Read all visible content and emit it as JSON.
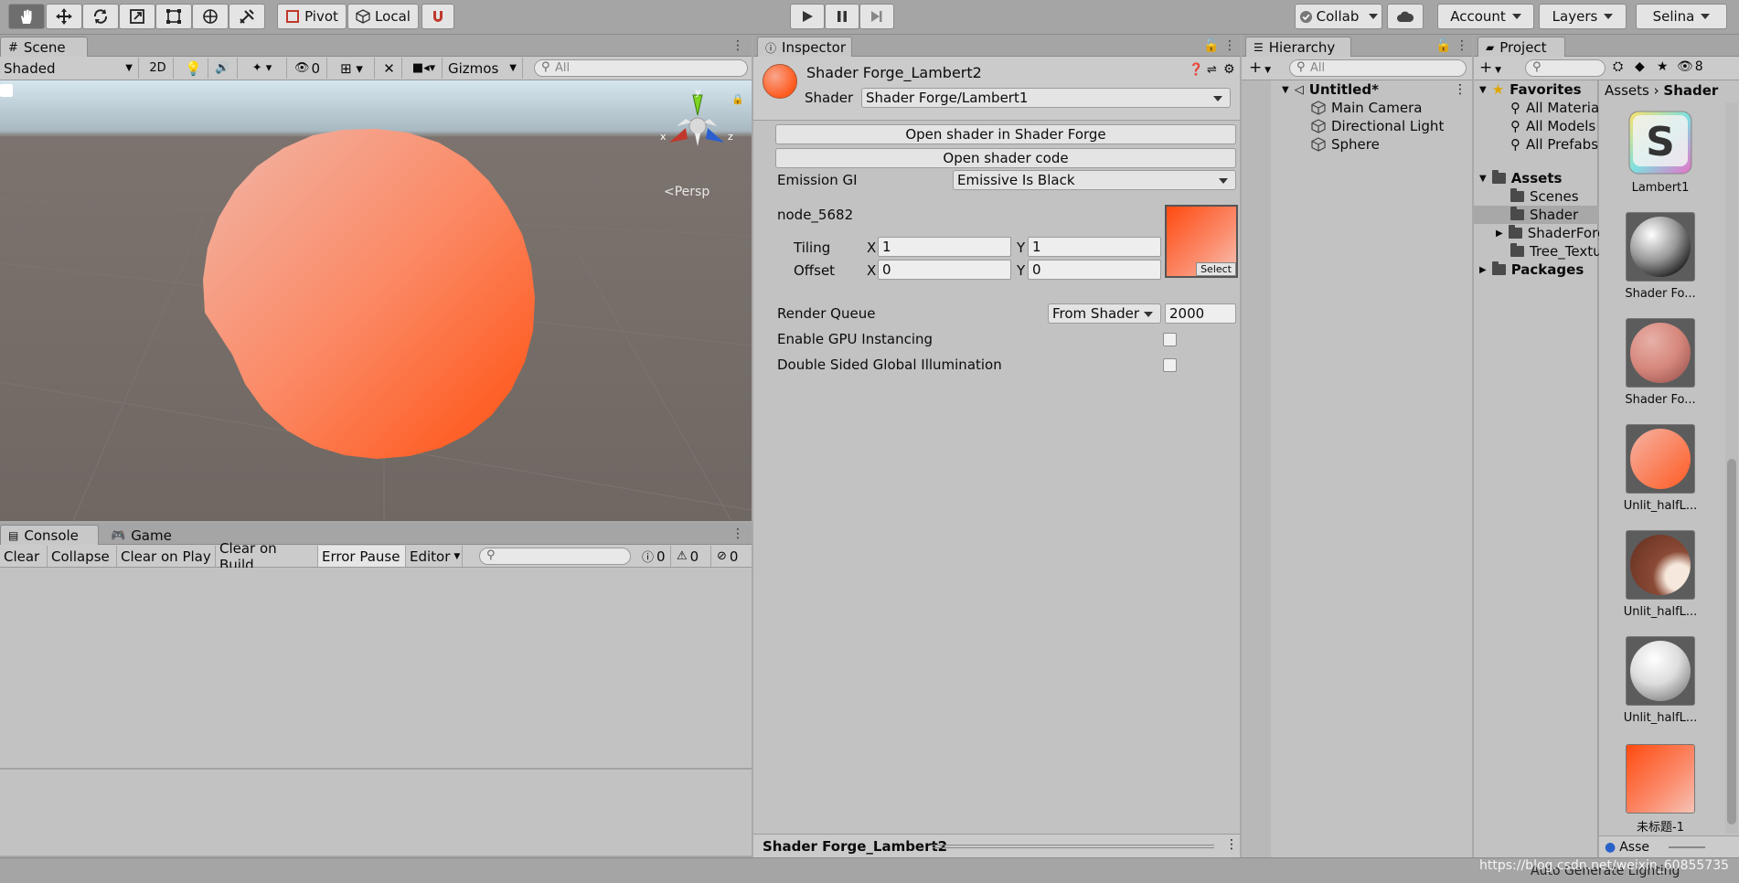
{
  "toolbar": {
    "pivot": "Pivot",
    "local": "Local",
    "collab": "Collab",
    "account": "Account",
    "layers": "Layers",
    "user": "Selina"
  },
  "scene": {
    "tab": "Scene",
    "shading": "Shaded",
    "mode2d": "2D",
    "hidden_count": "0",
    "gizmos": "Gizmos",
    "search_placeholder": "All",
    "persp": "Persp",
    "axis_x": "x",
    "axis_y": "y",
    "axis_z": "z"
  },
  "console": {
    "tab": "Console",
    "game_tab": "Game",
    "clear": "Clear",
    "collapse": "Collapse",
    "clear_on_play": "Clear on Play",
    "clear_on_build": "Clear on Build",
    "error_pause": "Error Pause",
    "editor": "Editor",
    "log_count": "0",
    "warn_count": "0",
    "error_count": "0"
  },
  "inspector": {
    "tab": "Inspector",
    "material_name": "Shader Forge_Lambert2",
    "shader_label": "Shader",
    "shader_value": "Shader Forge/Lambert1",
    "open_sf": "Open shader in Shader Forge",
    "open_code": "Open shader code",
    "emission_label": "Emission GI",
    "emission_value": "Emissive Is Black",
    "node_label": "node_5682",
    "tiling_label": "Tiling",
    "offset_label": "Offset",
    "x_label": "X",
    "y_label": "Y",
    "tiling_x": "1",
    "tiling_y": "1",
    "offset_x": "0",
    "offset_y": "0",
    "select": "Select",
    "render_queue_label": "Render Queue",
    "render_queue_mode": "From Shader",
    "render_queue_value": "2000",
    "gpu_instancing": "Enable GPU Instancing",
    "double_sided_gi": "Double Sided Global Illumination",
    "footer_name": "Shader Forge_Lambert2"
  },
  "hierarchy": {
    "tab": "Hierarchy",
    "search_placeholder": "All",
    "scene_name": "Untitled*",
    "items": [
      "Main Camera",
      "Directional Light",
      "Sphere"
    ]
  },
  "project": {
    "tab": "Project",
    "hidden_count": "8",
    "favorites": "Favorites",
    "fav_items": [
      "All Materia",
      "All Models",
      "All Prefabs"
    ],
    "assets": "Assets",
    "asset_folders": [
      "Scenes",
      "Shader",
      "ShaderForg",
      "Tree_Textu"
    ],
    "packages": "Packages",
    "breadcrumb_root": "Assets",
    "breadcrumb_current": "Shader",
    "thumbs": [
      "Lambert1",
      "Shader Fo...",
      "Shader Fo...",
      "Unlit_halfL...",
      "Unlit_halfL...",
      "Unlit_halfL...",
      "未标题-1"
    ],
    "bottom_path": "Asse"
  },
  "status": {
    "text": "Auto Generate Lighting",
    "watermark": "https://blog.csdn.net/weixin_60855735"
  },
  "colors": {
    "accent_orange": "#ff5a1e",
    "panel_bg": "#c2c2c2",
    "scene_ground": "#6f6762"
  }
}
